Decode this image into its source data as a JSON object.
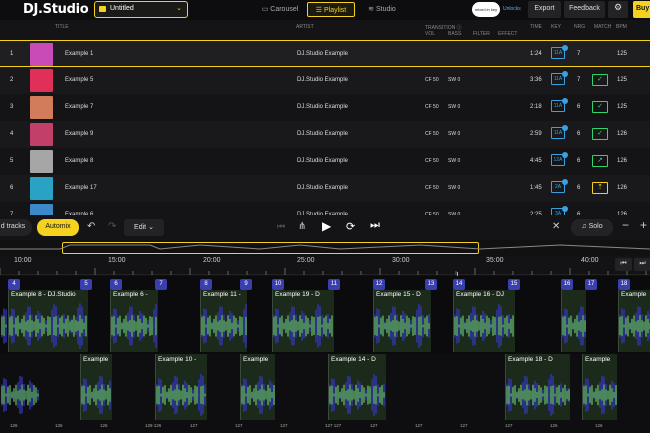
{
  "app": {
    "logo": "DJ.Studio",
    "project_name": "Untitled"
  },
  "view_tabs": [
    {
      "label": "Carousel"
    },
    {
      "label": "Playlist"
    },
    {
      "label": "Studio"
    }
  ],
  "top_right": {
    "beta_brand": "mixed in key",
    "beta_badge": "Unlocks",
    "export": "Export",
    "feedback": "Feedback",
    "buy": "Buy"
  },
  "columns": {
    "title": "TITLE",
    "artist": "ARTIST",
    "transition": "TRANSITION",
    "vol": "VOL",
    "bass": "BASS",
    "filter": "FILTER",
    "effect": "EFFECT",
    "time": "TIME",
    "key": "KEY",
    "nrg": "NRG",
    "match": "MATCH",
    "bpm": "BPM"
  },
  "tracks": [
    {
      "n": "1",
      "title": "Example 1",
      "artist": "DJ.Studio Example",
      "vol": "",
      "bass": "",
      "filter": "",
      "time": "1:24",
      "key": "11A",
      "nrg": "7",
      "match": "",
      "bpm": "125",
      "art": "#c94bb8"
    },
    {
      "n": "2",
      "title": "Example 5",
      "artist": "DJ.Studio Example",
      "vol": "CF 50",
      "bass": "SW 0",
      "filter": "",
      "time": "3:36",
      "key": "11A",
      "nrg": "7",
      "match": "check",
      "bpm": "125",
      "art": "#e0305a"
    },
    {
      "n": "3",
      "title": "Example 7",
      "artist": "DJ.Studio Example",
      "vol": "CF 50",
      "bass": "SW 0",
      "filter": "",
      "time": "2:18",
      "key": "11A",
      "nrg": "6",
      "match": "check",
      "bpm": "125",
      "art": "#d27c5c"
    },
    {
      "n": "4",
      "title": "Example 9",
      "artist": "DJ.Studio Example",
      "vol": "CF 50",
      "bass": "SW 0",
      "filter": "",
      "time": "2:59",
      "key": "11A",
      "nrg": "6",
      "match": "check",
      "bpm": "126",
      "art": "#c23f6a"
    },
    {
      "n": "5",
      "title": "Example 8",
      "artist": "DJ.Studio Example",
      "vol": "CF 50",
      "bass": "SW 0",
      "filter": "",
      "time": "4:45",
      "key": "12A",
      "nrg": "6",
      "match": "arrow",
      "bpm": "126",
      "art": "#a6a6a6"
    },
    {
      "n": "6",
      "title": "Example 17",
      "artist": "DJ.Studio Example",
      "vol": "CF 50",
      "bass": "SW 0",
      "filter": "",
      "time": "1:45",
      "key": "2A",
      "nrg": "6",
      "match": "up",
      "bpm": "126",
      "art": "#2aa2c4"
    },
    {
      "n": "7",
      "title": "Example 6",
      "artist": "DJ.Studio Example",
      "vol": "CF 50",
      "bass": "SW 0",
      "filter": "",
      "time": "2:25",
      "key": "3A",
      "nrg": "6",
      "match": "",
      "bpm": "126",
      "art": "#3c89c9"
    }
  ],
  "controls": {
    "add_tracks": "d tracks",
    "automix": "Automix",
    "edit": "Edit",
    "solo": "Solo"
  },
  "ruler": [
    "10:00",
    "15:00",
    "20:00",
    "25:00",
    "30:00",
    "35:00",
    "40:00"
  ],
  "clips_top": [
    {
      "num": "4",
      "label": "Example 8 - DJ.Studio"
    },
    {
      "num": "6",
      "label": "Example 6 -"
    },
    {
      "num": "8",
      "label": "Example 11 -"
    },
    {
      "num": "10",
      "label": "Example 19 - D"
    },
    {
      "num": "12",
      "label": "Example 15 - D"
    },
    {
      "num": "14",
      "label": "Example 16 - DJ"
    },
    {
      "num": "16",
      "label": ""
    },
    {
      "num": "18",
      "label": "Example"
    }
  ],
  "clip_nums_extra": [
    "5",
    "7",
    "9",
    "11",
    "13",
    "15",
    "17"
  ],
  "clips_bottom": [
    {
      "label": "Example"
    },
    {
      "label": "Example 10 -"
    },
    {
      "label": "Example"
    },
    {
      "label": "Example 14 - D"
    },
    {
      "label": "Example 18 - D"
    },
    {
      "label": "Example"
    }
  ],
  "bpm_labels": [
    "126",
    "126",
    "126",
    "128 126",
    "127",
    "127",
    "127",
    "127 127",
    "127",
    "127",
    "127",
    "127",
    "126",
    "126"
  ]
}
